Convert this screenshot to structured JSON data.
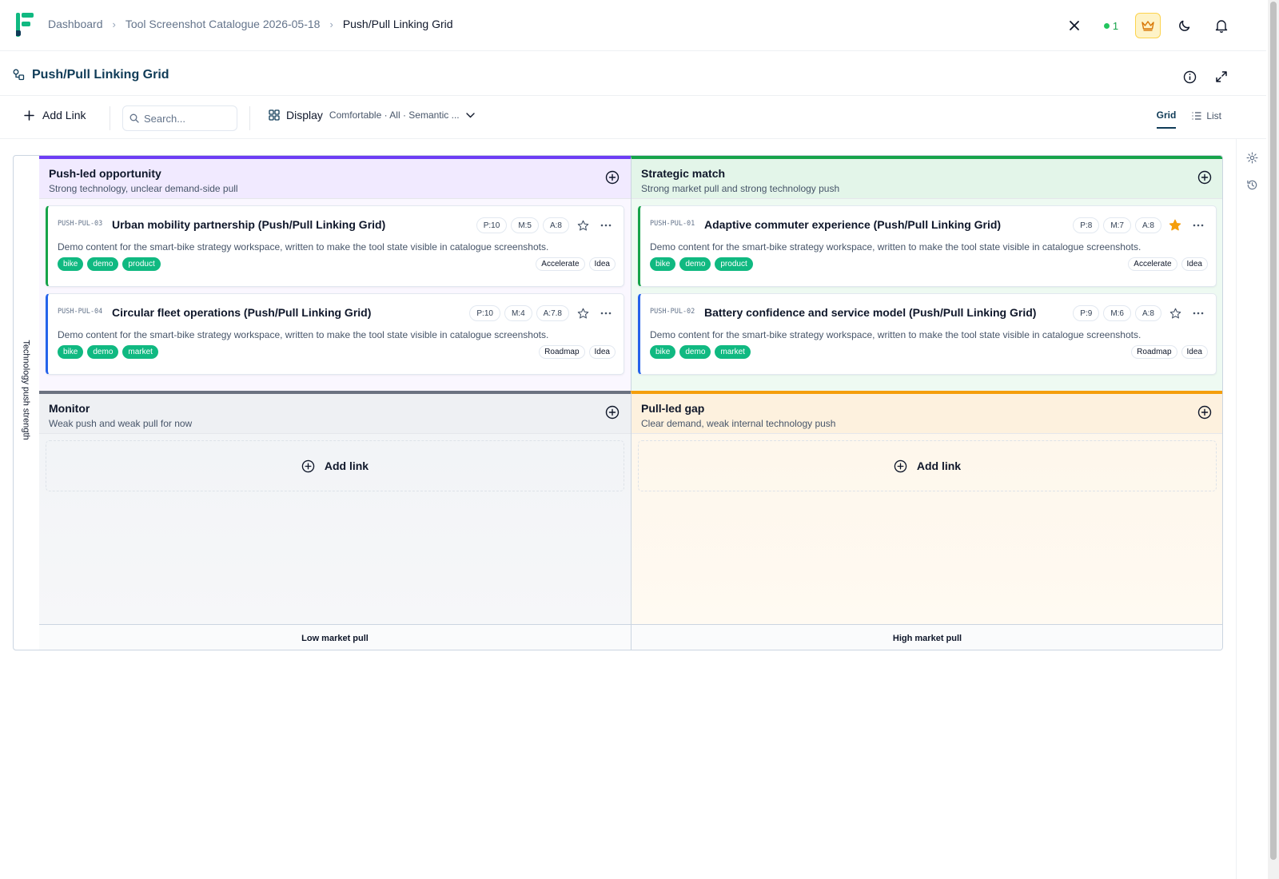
{
  "breadcrumb": {
    "items": [
      "Dashboard",
      "Tool Screenshot Catalogue 2026-05-18"
    ],
    "current": "Push/Pull Linking Grid"
  },
  "topbar": {
    "presence_count": "1"
  },
  "page": {
    "title": "Push/Pull Linking Grid"
  },
  "toolbar": {
    "add_label": "Add Link",
    "search_placeholder": "Search...",
    "display_label": "Display",
    "display_summary": "Comfortable · All · Semantic ...",
    "views": [
      "Grid",
      "List"
    ],
    "active_view": "Grid"
  },
  "axes": {
    "y_label": "Technology push strength",
    "x_low": "Low market pull",
    "x_high": "High market pull"
  },
  "quadrants": {
    "push_led": {
      "title": "Push-led opportunity",
      "subtitle": "Strong technology, unclear demand-side pull",
      "color": "#6d3df5",
      "cards": [
        {
          "id": "PUSH-PUL-03",
          "title": "Urban mobility partnership (Push/Pull Linking Grid)",
          "p": "P:10",
          "m": "M:5",
          "a": "A:8",
          "starred": false,
          "description": "Demo content for the smart-bike strategy workspace, written to make the tool state visible in catalogue screenshots.",
          "tags": [
            "bike",
            "demo",
            "product"
          ],
          "action": "Accelerate",
          "stage": "Idea",
          "accent": "#16a34a"
        },
        {
          "id": "PUSH-PUL-04",
          "title": "Circular fleet operations (Push/Pull Linking Grid)",
          "p": "P:10",
          "m": "M:4",
          "a": "A:7.8",
          "starred": false,
          "description": "Demo content for the smart-bike strategy workspace, written to make the tool state visible in catalogue screenshots.",
          "tags": [
            "bike",
            "demo",
            "market"
          ],
          "action": "Roadmap",
          "stage": "Idea",
          "accent": "#2563eb"
        }
      ]
    },
    "strategic": {
      "title": "Strategic match",
      "subtitle": "Strong market pull and strong technology push",
      "color": "#16a34a",
      "cards": [
        {
          "id": "PUSH-PUL-01",
          "title": "Adaptive commuter experience (Push/Pull Linking Grid)",
          "p": "P:8",
          "m": "M:7",
          "a": "A:8",
          "starred": true,
          "description": "Demo content for the smart-bike strategy workspace, written to make the tool state visible in catalogue screenshots.",
          "tags": [
            "bike",
            "demo",
            "product"
          ],
          "action": "Accelerate",
          "stage": "Idea",
          "accent": "#16a34a"
        },
        {
          "id": "PUSH-PUL-02",
          "title": "Battery confidence and service model (Push/Pull Linking Grid)",
          "p": "P:9",
          "m": "M:6",
          "a": "A:8",
          "starred": false,
          "description": "Demo content for the smart-bike strategy workspace, written to make the tool state visible in catalogue screenshots.",
          "tags": [
            "bike",
            "demo",
            "market"
          ],
          "action": "Roadmap",
          "stage": "Idea",
          "accent": "#2563eb"
        }
      ]
    },
    "monitor": {
      "title": "Monitor",
      "subtitle": "Weak push and weak pull for now",
      "color": "#6b7280",
      "add_label": "Add link"
    },
    "pull_led": {
      "title": "Pull-led gap",
      "subtitle": "Clear demand, weak internal technology push",
      "color": "#f59e0b",
      "add_label": "Add link"
    }
  },
  "icons": {
    "logo": "app-logo-icon",
    "close": "close-icon",
    "crown": "crown-icon",
    "theme": "moon-icon",
    "notifications": "bell-icon",
    "info": "info-icon",
    "expand": "expand-icon",
    "settings": "gear-icon",
    "history": "history-icon"
  }
}
